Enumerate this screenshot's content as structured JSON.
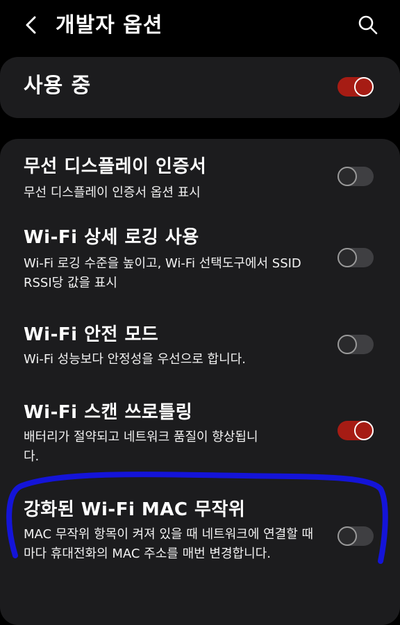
{
  "header": {
    "title": "개발자 옵션",
    "back_icon": "chevron-left-icon",
    "search_icon": "search-icon"
  },
  "master": {
    "label": "사용 중",
    "enabled": true
  },
  "settings": [
    {
      "title": "무선 디스플레이 인증서",
      "desc": "무선 디스플레이 인증서 옵션 표시",
      "enabled": false
    },
    {
      "title": "Wi-Fi 상세 로깅 사용",
      "desc": "Wi-Fi 로깅 수준을 높이고, Wi-Fi 선택도구에서 SSID RSSI당 값을 표시",
      "enabled": false
    },
    {
      "title": "Wi-Fi 안전 모드",
      "desc": "Wi-Fi 성능보다 안정성을 우선으로 합니다.",
      "enabled": false
    },
    {
      "title": "Wi-Fi 스캔 쓰로틀링",
      "desc": "배터리가 절약되고 네트워크 품질이 향상됩니다.",
      "enabled": true
    },
    {
      "title": "강화된 Wi-Fi MAC 무작위",
      "desc": "MAC 무작위 항목이 켜져 있을 때 네트워크에 연결할 때마다 휴대전화의 MAC 주소를 매번 변경합니다.",
      "enabled": false
    }
  ],
  "colors": {
    "background": "#000000",
    "card": "#1c1c1e",
    "toggle_on": "#a61c14",
    "toggle_off": "#3f3f42",
    "annotation": "#1414d8"
  }
}
